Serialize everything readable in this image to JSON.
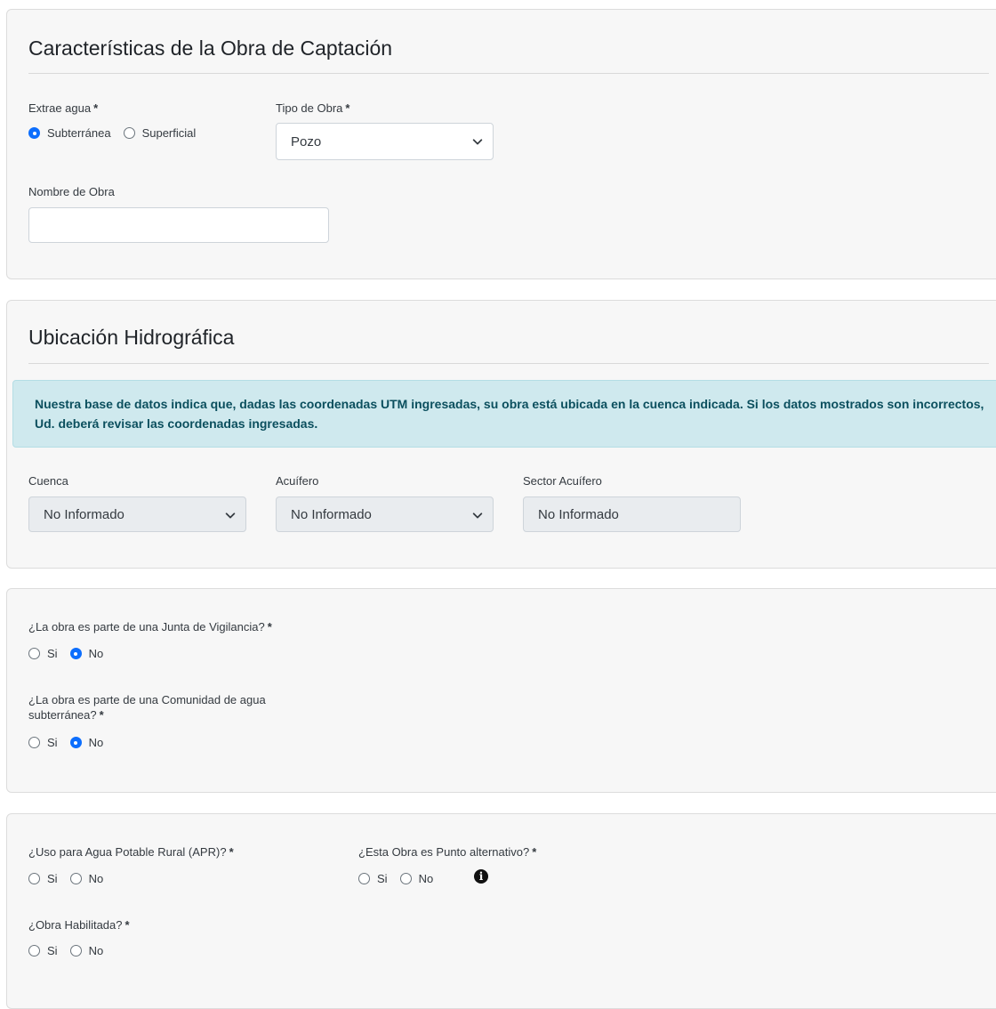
{
  "captacion": {
    "title": "Características de la Obra de Captación",
    "extrae_agua": {
      "label": "Extrae agua",
      "required": "*",
      "options": [
        "Subterránea",
        "Superficial"
      ],
      "selected": "Subterránea"
    },
    "tipo_obra": {
      "label": "Tipo de Obra",
      "required": "*",
      "value": "Pozo"
    },
    "nombre_obra": {
      "label": "Nombre de Obra",
      "value": ""
    }
  },
  "ubicacion": {
    "title": "Ubicación Hidrográfica",
    "alert": "Nuestra base de datos indica que, dadas las coordenadas UTM ingresadas, su obra está ubicada en la cuenca indicada. Si los datos mostrados son incorrectos, Ud. deberá revisar las coordenadas ingresadas.",
    "cuenca": {
      "label": "Cuenca",
      "value": "No Informado"
    },
    "acuifero": {
      "label": "Acuífero",
      "value": "No Informado"
    },
    "sector_acuifero": {
      "label": "Sector Acuífero",
      "value": "No Informado"
    }
  },
  "organizaciones": {
    "junta_vigilancia": {
      "label": "¿La obra es parte de una Junta de Vigilancia?",
      "required": "*",
      "options": [
        "Si",
        "No"
      ],
      "selected": "No"
    },
    "comunidad_agua": {
      "label_line1": "¿La obra es parte de una Comunidad de agua",
      "label_line2": "subterránea?",
      "required": "*",
      "options": [
        "Si",
        "No"
      ],
      "selected": "No"
    }
  },
  "uso": {
    "apr": {
      "label": "¿Uso para Agua Potable Rural (APR)?",
      "required": "*",
      "options": [
        "Si",
        "No"
      ],
      "selected": ""
    },
    "punto_alternativo": {
      "label": "¿Esta Obra es Punto alternativo?",
      "required": "*",
      "options": [
        "Si",
        "No"
      ],
      "selected": "",
      "info_icon": "info-circle-icon"
    },
    "habilitada": {
      "label": "¿Obra Habilitada?",
      "required": "*",
      "options": [
        "Si",
        "No"
      ],
      "selected": ""
    }
  },
  "colors": {
    "accent": "#0d6efd",
    "card_bg": "#f7f7f7",
    "alert_bg": "#cfe9ee",
    "alert_text": "#0b4f5e",
    "disabled_bg": "#e9ecef"
  }
}
